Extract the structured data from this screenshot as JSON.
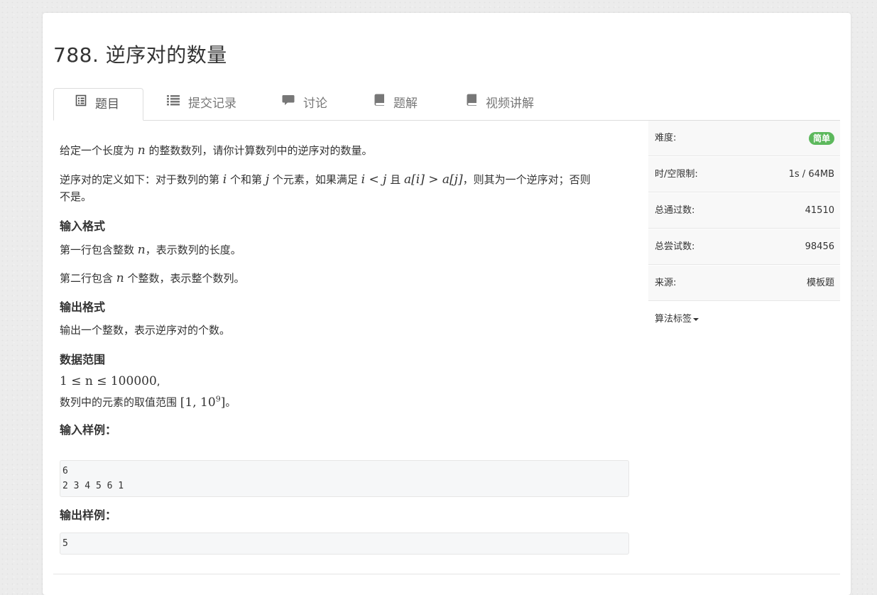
{
  "problem": {
    "title": "788. 逆序对的数量"
  },
  "tabs": [
    {
      "label": "题目",
      "icon": "document-icon",
      "active": true
    },
    {
      "label": "提交记录",
      "icon": "list-icon"
    },
    {
      "label": "讨论",
      "icon": "comment-icon"
    },
    {
      "label": "题解",
      "icon": "book-icon"
    },
    {
      "label": "视频讲解",
      "icon": "book-icon"
    }
  ],
  "statement": {
    "line1_pre": "给定一个长度为",
    "line1_var": "n",
    "line1_post": "的整数数列，请你计算数列中的逆序对的数量。",
    "def_pre": "逆序对的定义如下：对于数列的第",
    "def_i": "i",
    "def_mid1": "个和第",
    "def_j": "j",
    "def_mid2": "个元素，如果满足",
    "def_cond1": "i < j",
    "def_and": "且",
    "def_cond2": "a[i] > a[j]",
    "def_post": "，则其为一个逆序对；否则",
    "def_line2": "不是。",
    "input_heading": "输入格式",
    "input_l1_pre": "第一行包含整数",
    "input_l1_var": "n",
    "input_l1_post": "，表示数列的长度。",
    "input_l2_pre": "第二行包含",
    "input_l2_var": "n",
    "input_l2_post": "个整数，表示整个数列。",
    "output_heading": "输出格式",
    "output_line": "输出一个整数，表示逆序对的个数。",
    "range_heading": "数据范围",
    "range_formula": "1 ≤ n ≤ 100000",
    "range_comma": ",",
    "range_l2_pre": "数列中的元素的取值范围",
    "range_l2_formula_base": "[1, 10",
    "range_l2_formula_exp": "9",
    "range_l2_formula_close": "]",
    "range_l2_post": "。",
    "sample_in_heading": "输入样例：",
    "sample_in": "6\n2 3 4 5 6 1",
    "sample_out_heading": "输出样例：",
    "sample_out": "5"
  },
  "sidebar": {
    "difficulty_label": "难度:",
    "difficulty_value": "简单",
    "difficulty_color": "#5cb85c",
    "limit_label": "时/空限制:",
    "limit_value": "1s / 64MB",
    "passed_label": "总通过数:",
    "passed_value": "41510",
    "tried_label": "总尝试数:",
    "tried_value": "98456",
    "source_label": "来源:",
    "source_value": "模板题",
    "tags_label": "算法标签"
  }
}
